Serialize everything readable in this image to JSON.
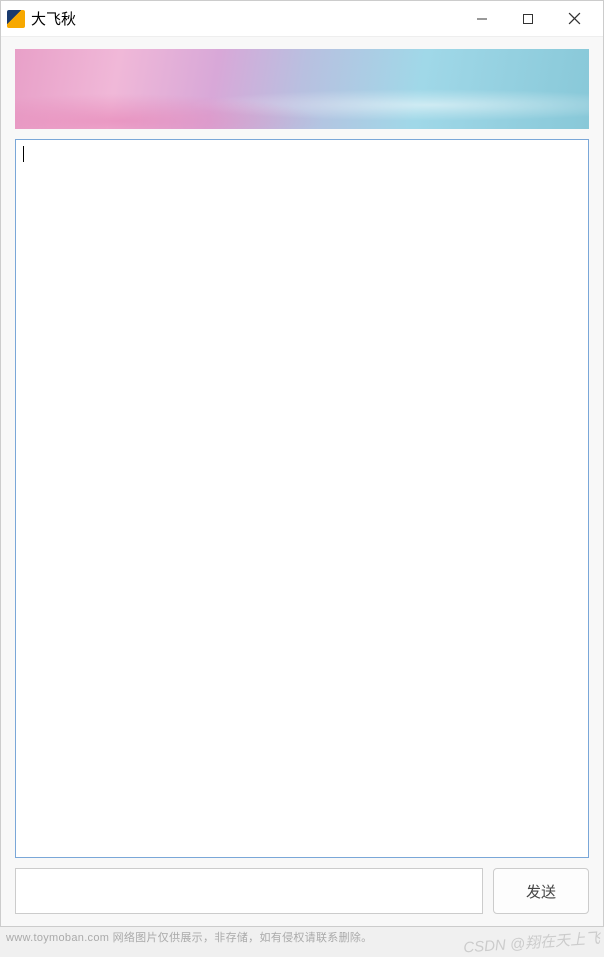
{
  "window": {
    "title": "大飞秋"
  },
  "chat": {
    "display_content": "",
    "input_value": "",
    "send_label": "发送"
  },
  "footer": {
    "source_text": "www.toymoban.com 网络图片仅供展示，非存储，如有侵权请联系删除。",
    "watermark": "CSDN @翔在天上飞"
  }
}
